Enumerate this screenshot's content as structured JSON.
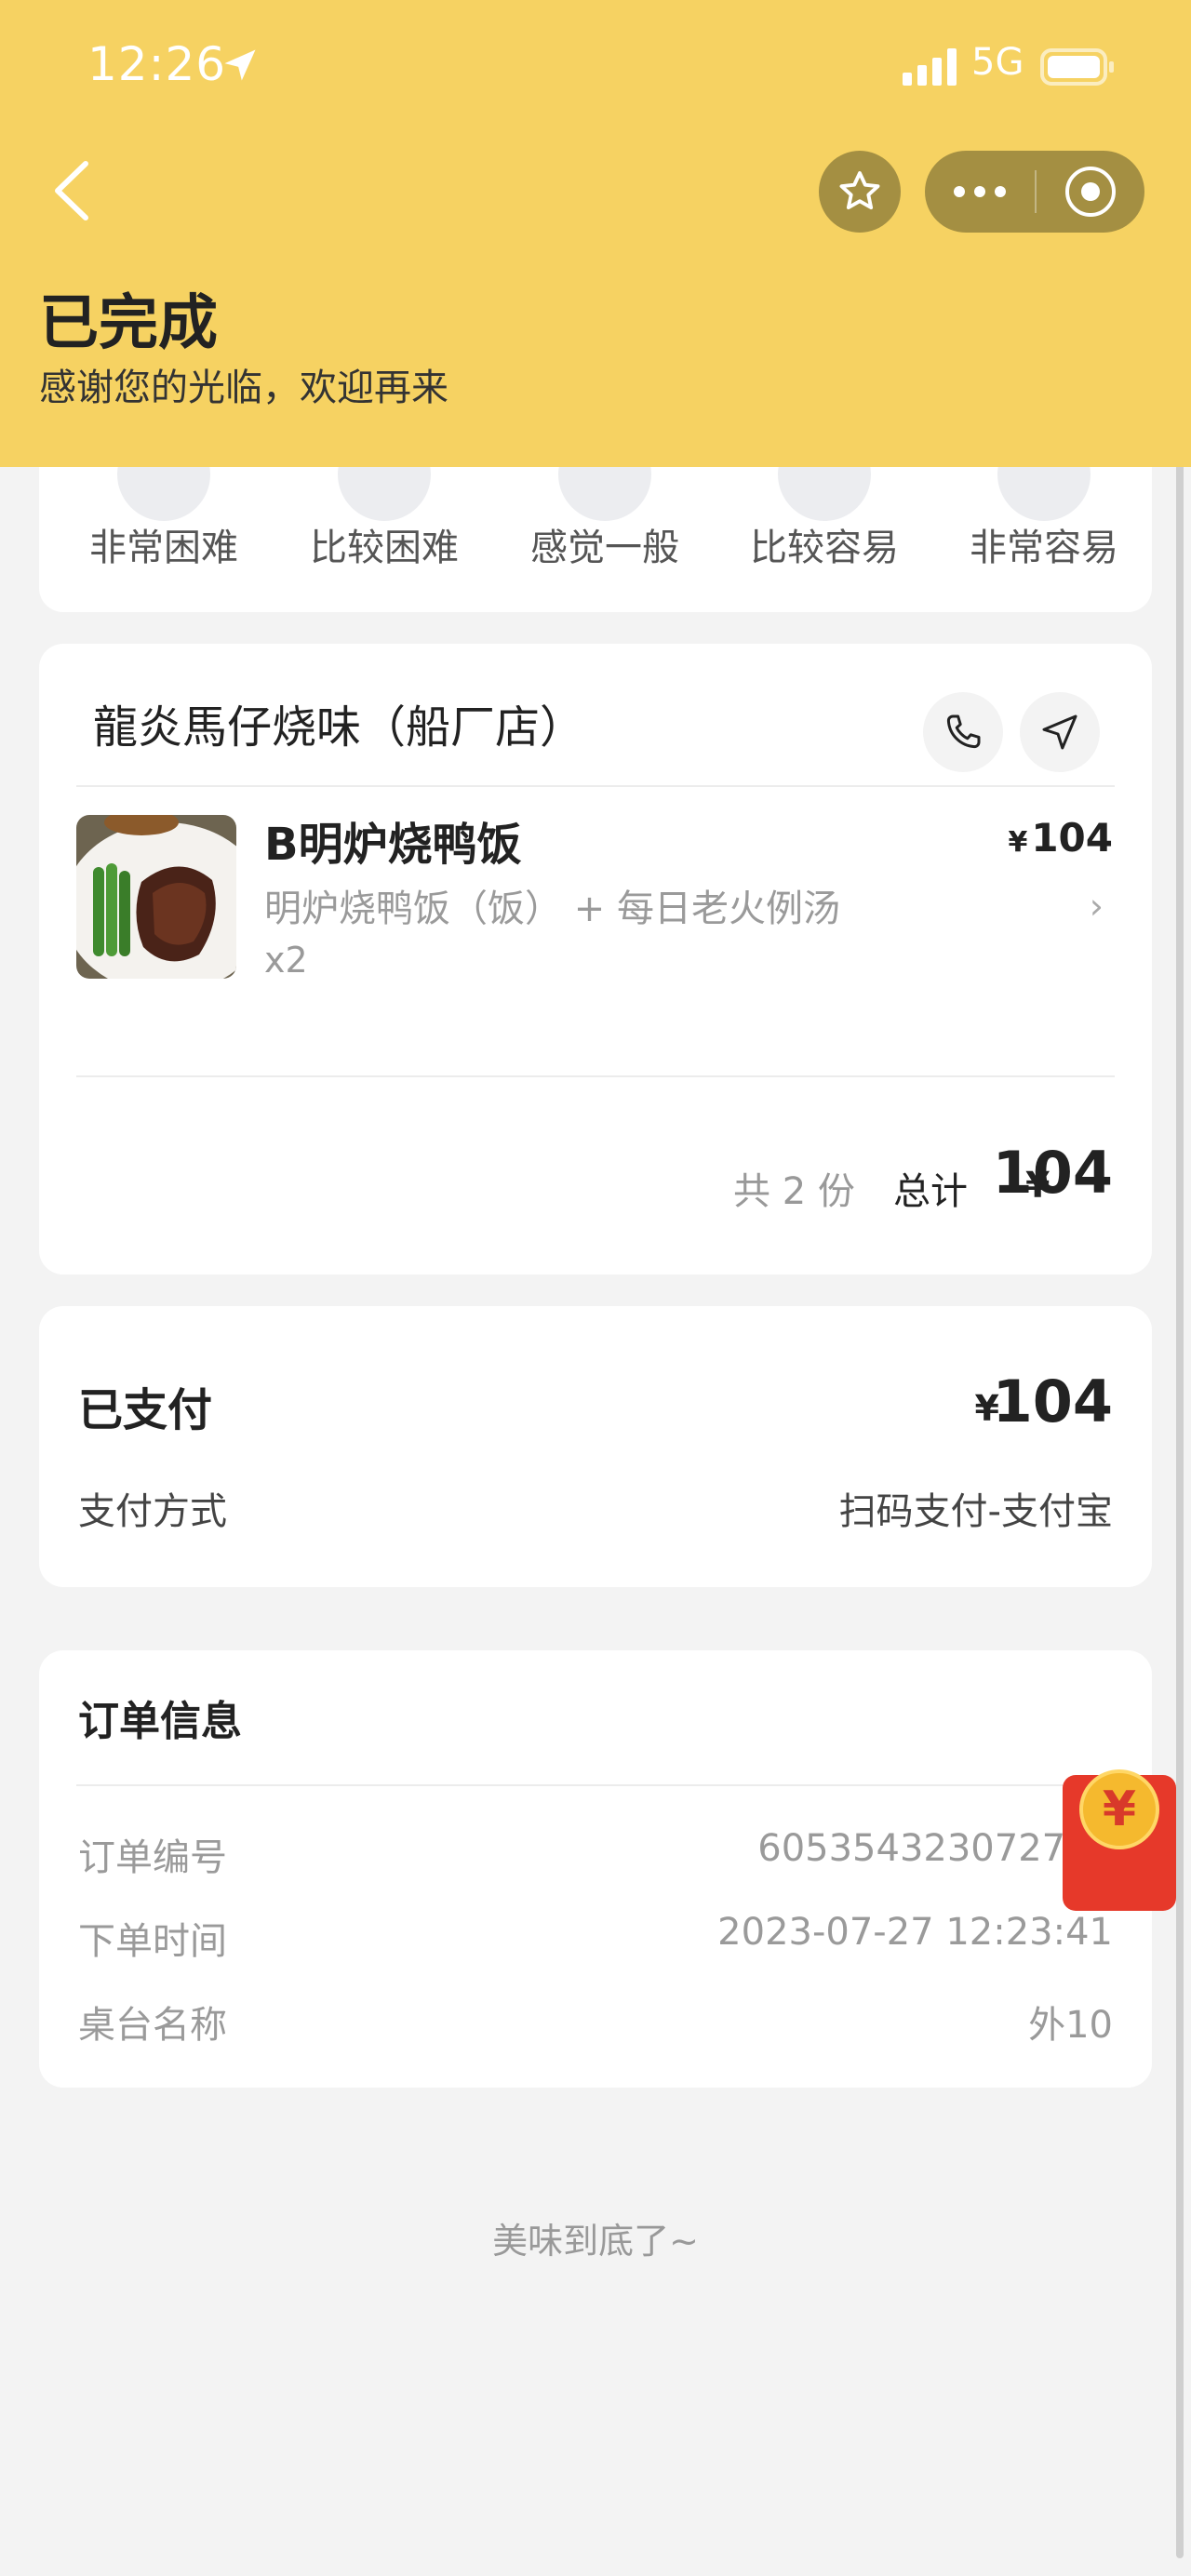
{
  "status_bar": {
    "time": "12:26",
    "network": "5G"
  },
  "header": {
    "status": "已完成",
    "subtitle": "感谢您的光临，欢迎再来"
  },
  "rating": {
    "options": [
      "非常困难",
      "比较困难",
      "感觉一般",
      "比较容易",
      "非常容易"
    ]
  },
  "store": {
    "name": "龍炎馬仔烧味（船厂店）",
    "item": {
      "name": "B明炉烧鸭饭",
      "currency": "¥",
      "price": "104",
      "options": "明炉烧鸭饭（饭） + 每日老火例汤",
      "quantity": "x2"
    },
    "count_text": "共 2 份",
    "total_label": "总计",
    "total_currency": "¥",
    "total": "104"
  },
  "payment": {
    "paid_label": "已支付",
    "currency": "¥",
    "amount": "104",
    "method_label": "支付方式",
    "method": "扫码支付-支付宝"
  },
  "order_info": {
    "title": "订单信息",
    "rows": [
      {
        "label": "订单编号",
        "value": "605354323072700"
      },
      {
        "label": "下单时间",
        "value": "2023-07-27 12:23:41"
      },
      {
        "label": "桌台名称",
        "value": "外10"
      }
    ]
  },
  "footer": "美味到底了~",
  "red_packet": {
    "glyph": "¥"
  },
  "colors": {
    "header_bg": "#f6d262",
    "capsule": "#a48f42",
    "red_packet": "#e6392a"
  }
}
